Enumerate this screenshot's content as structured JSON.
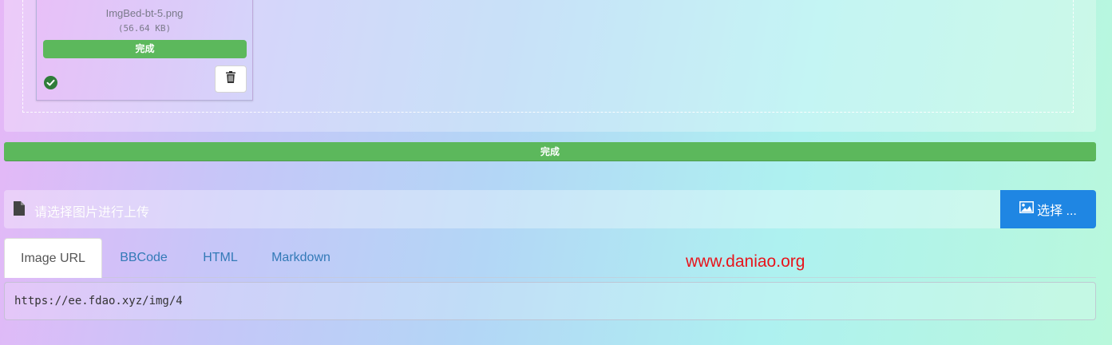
{
  "file_card": {
    "file_name": "ImgBed-bt-5.png",
    "file_size": "(56.64 KB)",
    "progress_label": "完成",
    "progress_percent": 100,
    "status_icon": "check-circle-icon",
    "remove_icon": "trash-icon"
  },
  "overall_progress": {
    "label": "完成",
    "percent": 100
  },
  "upload": {
    "file_icon": "file-icon",
    "caption": "请选择图片进行上传",
    "choose_label": "选择 ...",
    "choose_icon": "image-icon"
  },
  "tabs": [
    {
      "label": "Image URL",
      "active": true
    },
    {
      "label": "BBCode",
      "active": false
    },
    {
      "label": "HTML",
      "active": false
    },
    {
      "label": "Markdown",
      "active": false
    }
  ],
  "watermark": "www.daniao.org",
  "output": {
    "value": "https://ee.fdao.xyz/img/4"
  },
  "colors": {
    "success": "#5cb85c",
    "primary": "#1f86e3",
    "link": "#337ab7",
    "watermark": "#e8141b"
  }
}
